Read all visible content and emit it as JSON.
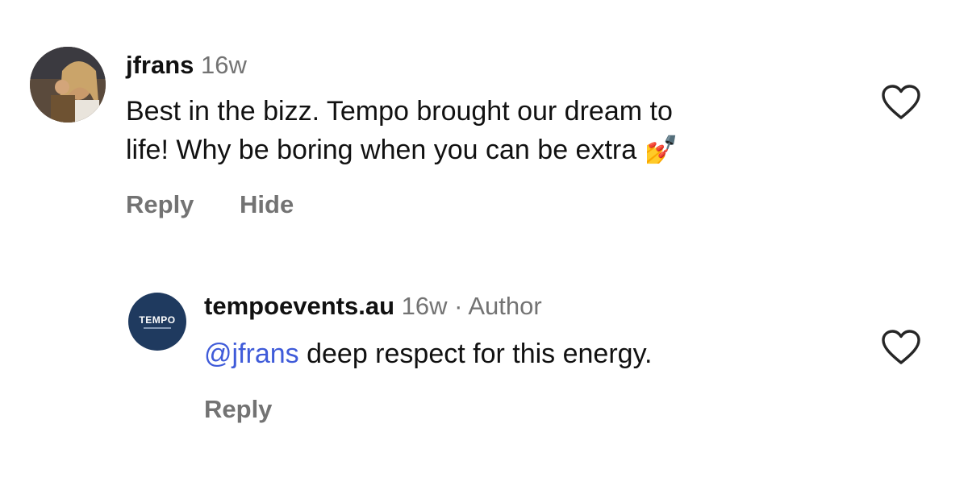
{
  "comments": [
    {
      "username": "jfrans",
      "time": "16w",
      "text_line1": "Best in the bizz. Tempo brought our dream to",
      "text_line2": "life! Why be boring when you can be extra ",
      "emoji": "💅",
      "actions": [
        "Reply",
        "Hide"
      ],
      "avatar": "profile-photo"
    },
    {
      "username": "tempoevents.au",
      "time": "16w",
      "separator": "·",
      "author_label": "Author",
      "mention": "@jfrans",
      "text": " deep respect for this energy.",
      "actions": [
        "Reply"
      ],
      "avatar_text": "TEMPO"
    }
  ],
  "icons": {
    "like": "heart-outline-icon"
  },
  "colors": {
    "mention": "#3f5bd9",
    "muted": "#737373",
    "brand_avatar": "#1f3a5f"
  }
}
